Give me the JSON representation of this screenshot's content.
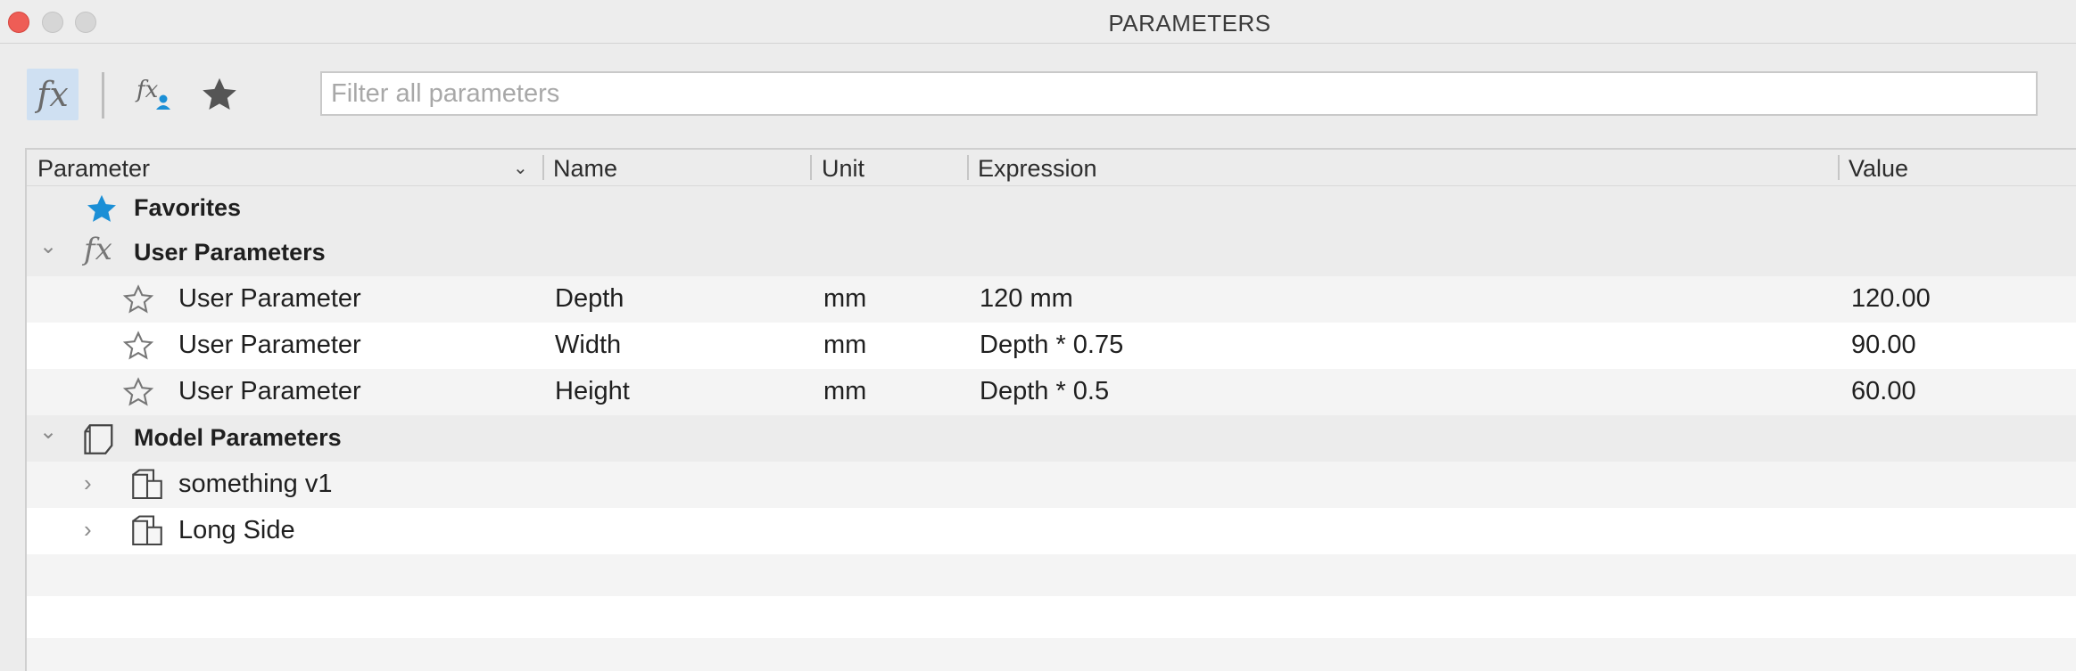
{
  "window": {
    "title": "PARAMETERS"
  },
  "toolbar": {
    "buttons": [
      {
        "icon": "fx-icon",
        "glyph": "fx",
        "active": true
      },
      {
        "icon": "user-fx-icon",
        "glyph": "fx",
        "active": false
      },
      {
        "icon": "star-icon",
        "glyph": "★",
        "active": false
      }
    ],
    "filter_placeholder": "Filter all parameters"
  },
  "columns": {
    "parameter": "Parameter",
    "name": "Name",
    "unit": "Unit",
    "expression": "Expression",
    "value": "Value"
  },
  "groups": {
    "favorites": {
      "label": "Favorites",
      "icon": "star-filled-icon",
      "color": "#1b8fd6"
    },
    "user": {
      "label": "User Parameters",
      "icon": "fx-icon"
    },
    "model": {
      "label": "Model Parameters",
      "icon": "cube-icon"
    }
  },
  "user_parameters": [
    {
      "parameter": "User Parameter",
      "name": "Depth",
      "unit": "mm",
      "expression": "120 mm",
      "value": "120.00"
    },
    {
      "parameter": "User Parameter",
      "name": "Width",
      "unit": "mm",
      "expression": "Depth * 0.75",
      "value": "90.00"
    },
    {
      "parameter": "User Parameter",
      "name": "Height",
      "unit": "mm",
      "expression": "Depth * 0.5",
      "value": "60.00"
    }
  ],
  "model_parameters": [
    {
      "label": "something v1"
    },
    {
      "label": "Long Side"
    }
  ]
}
